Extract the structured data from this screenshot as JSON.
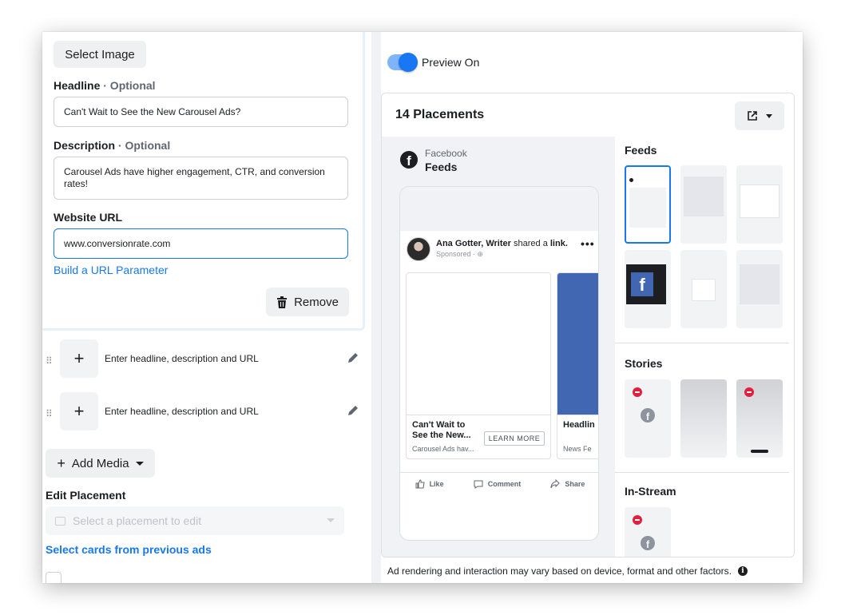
{
  "left": {
    "select_image_label": "Select Image",
    "headline": {
      "label": "Headline",
      "optional": "· Optional",
      "value": "Can't Wait to See the New Carousel Ads?"
    },
    "description": {
      "label": "Description",
      "optional": "· Optional",
      "value": "Carousel Ads have higher engagement, CTR, and conversion rates!"
    },
    "website_url": {
      "label": "Website URL",
      "value": "www.conversionrate.com"
    },
    "build_url_link": "Build a URL Parameter",
    "remove_label": "Remove",
    "collapsed_cards": [
      {
        "text": "Enter headline, description and URL"
      },
      {
        "text": "Enter headline, description and URL"
      }
    ],
    "add_media_label": "Add Media",
    "edit_placement_title": "Edit Placement",
    "placement_select_placeholder": "Select a placement to edit",
    "select_cards_link": "Select cards from previous ads"
  },
  "right": {
    "preview_toggle_label": "Preview On",
    "placements_title": "14 Placements",
    "preview": {
      "platform": "Facebook",
      "position": "Feeds",
      "post": {
        "author_name": "Ana Gotter, Writer",
        "author_action": "shared a",
        "author_action_link": "link.",
        "sponsored": "Sponsored · ⊕",
        "more": "•••",
        "cards": [
          {
            "headline_line1": "Can't Wait to",
            "headline_line2": "See the New...",
            "description": "Carousel Ads hav...",
            "cta": "LEARN MORE"
          },
          {
            "headline_line1": "Headlin",
            "description": "News Fe"
          }
        ],
        "actions": [
          "Like",
          "Comment",
          "Share"
        ]
      }
    },
    "sections": {
      "feeds": "Feeds",
      "stories": "Stories",
      "in_stream": "In-Stream"
    },
    "footer_note": "Ad rendering and interaction may vary based on device, format and other factors."
  },
  "colors": {
    "accent": "#1877f2",
    "blocked": "#e41e3f",
    "fb_card_blue": "#4267b2"
  }
}
